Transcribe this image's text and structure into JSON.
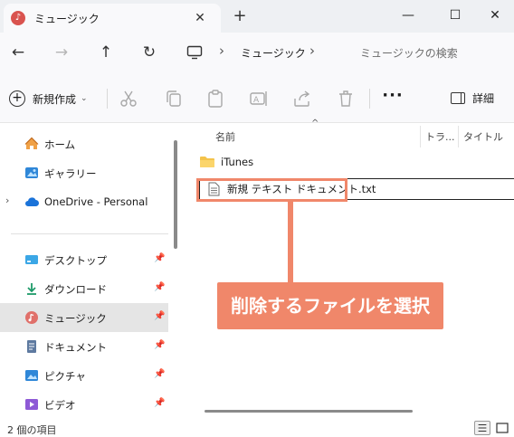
{
  "window": {
    "tab_title": "ミュージック",
    "tab_icon": "music-icon",
    "close_tab_glyph": "✕",
    "new_tab_glyph": "+",
    "minimize_glyph": "—",
    "maximize_glyph": "☐",
    "close_glyph": "✕"
  },
  "address": {
    "back_glyph": "←",
    "forward_glyph": "→",
    "up_glyph": "↑",
    "refresh_glyph": "↻",
    "separator": "›",
    "breadcrumb": "ミュージック",
    "search_placeholder": "ミュージックの検索"
  },
  "toolbar": {
    "new_label": "新規作成",
    "new_chevron": "⌄",
    "more_glyph": "···",
    "details_label": "詳細"
  },
  "sidebar": {
    "expand_glyph": "›",
    "pin_glyph": "📌",
    "items": [
      {
        "label": "ホーム",
        "icon": "home-icon"
      },
      {
        "label": "ギャラリー",
        "icon": "gallery-icon"
      },
      {
        "label": "OneDrive - Personal",
        "icon": "onedrive-icon"
      },
      {
        "label": "デスクトップ",
        "icon": "desktop-icon"
      },
      {
        "label": "ダウンロード",
        "icon": "download-icon"
      },
      {
        "label": "ミュージック",
        "icon": "music-icon"
      },
      {
        "label": "ドキュメント",
        "icon": "documents-icon"
      },
      {
        "label": "ピクチャ",
        "icon": "pictures-icon"
      },
      {
        "label": "ビデオ",
        "icon": "videos-icon"
      }
    ]
  },
  "content": {
    "sort_glyph": "^",
    "columns": [
      "名前",
      "トラ...",
      "タイトル"
    ],
    "files": [
      {
        "name": "iTunes",
        "icon": "folder-icon"
      },
      {
        "name": "新規 テキスト ドキュメント.txt",
        "icon": "text-file-icon"
      }
    ]
  },
  "annotation": {
    "text": "削除するファイルを選択",
    "color": "#f0876a"
  },
  "status": {
    "item_count": "2 個の項目"
  }
}
